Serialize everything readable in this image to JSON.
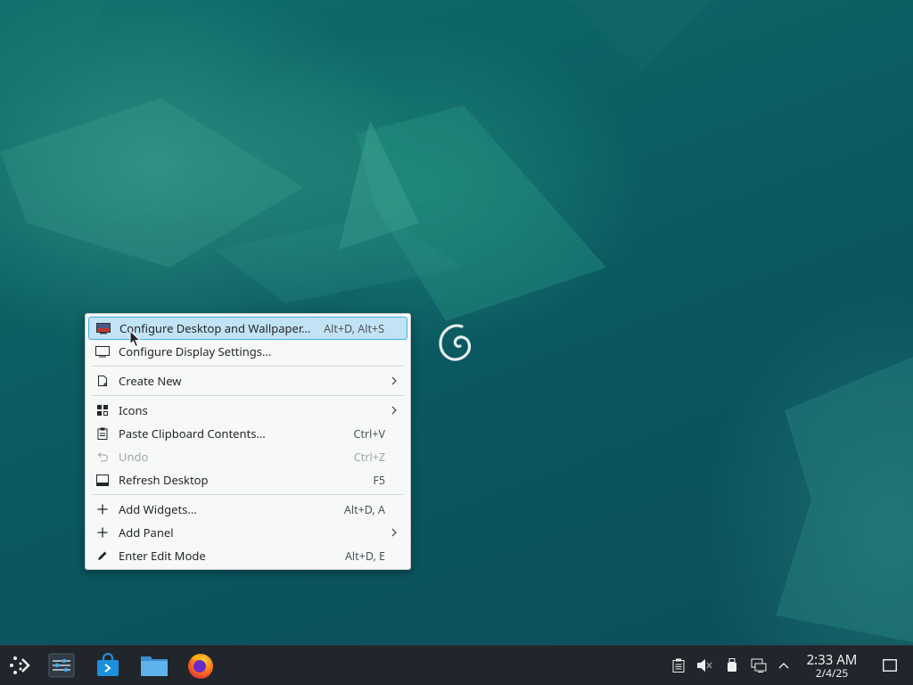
{
  "context_menu": {
    "items": [
      {
        "label": "Configure Desktop and Wallpaper…",
        "shortcut": "Alt+D, Alt+S",
        "icon": "wallpaper-icon",
        "highlighted": true
      },
      {
        "label": "Configure Display Settings…",
        "shortcut": "",
        "icon": "display-icon"
      },
      {
        "label": "Create New",
        "shortcut": "",
        "icon": "new-file-icon",
        "submenu": true
      },
      {
        "label": "Icons",
        "shortcut": "",
        "icon": "grid-icon",
        "submenu": true
      },
      {
        "label": "Paste Clipboard Contents…",
        "shortcut": "Ctrl+V",
        "icon": "clipboard-icon"
      },
      {
        "label": "Undo",
        "shortcut": "Ctrl+Z",
        "icon": "undo-icon",
        "disabled": true
      },
      {
        "label": "Refresh Desktop",
        "shortcut": "F5",
        "icon": "refresh-desktop-icon"
      },
      {
        "label": "Add Widgets…",
        "shortcut": "Alt+D, A",
        "icon": "plus-icon"
      },
      {
        "label": "Add Panel",
        "shortcut": "",
        "icon": "plus-icon",
        "submenu": true
      },
      {
        "label": "Enter Edit Mode",
        "shortcut": "Alt+D, E",
        "icon": "pencil-icon"
      }
    ]
  },
  "taskbar": {
    "apps": [
      "application-launcher-icon",
      "system-settings-icon",
      "software-store-icon",
      "file-manager-icon",
      "firefox-icon"
    ],
    "tray": [
      "clipboard-icon",
      "volume-muted-icon",
      "usb-drive-icon",
      "network-icon",
      "chevron-up-icon"
    ],
    "clock": {
      "time": "2:33 AM",
      "date": "2/4/25"
    }
  },
  "colors": {
    "highlight": "#c2e3f5",
    "highlight_border": "#3daee9",
    "panel": "#20262b",
    "menu_bg": "#f7f8f8"
  }
}
